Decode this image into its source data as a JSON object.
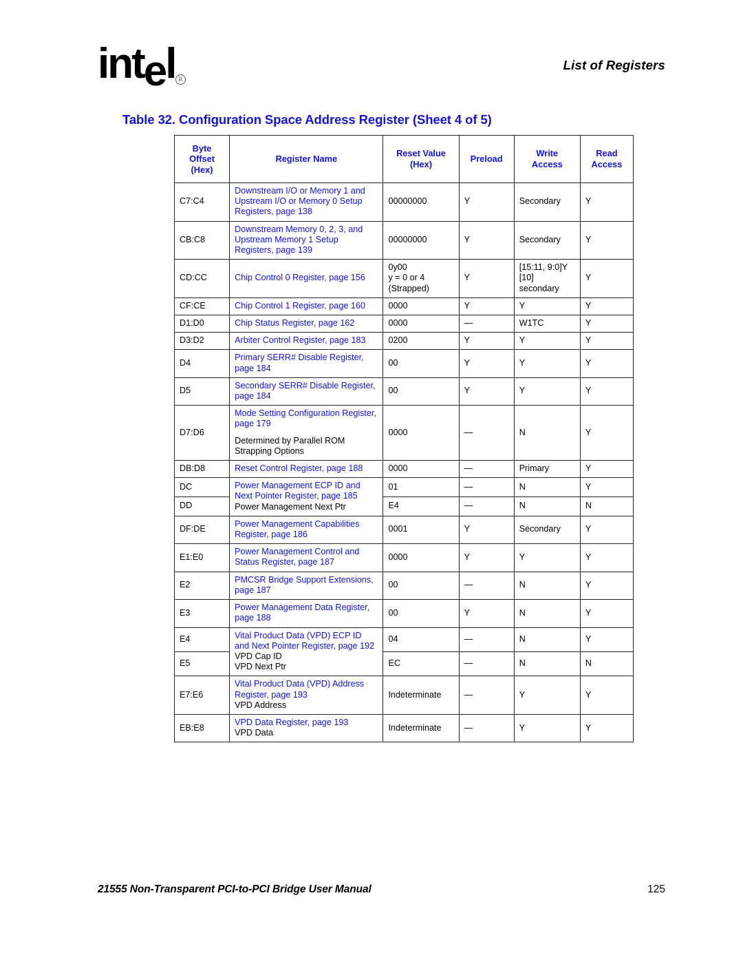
{
  "header": {
    "logo_text_before": "int",
    "logo_text_e": "e",
    "logo_text_after": "l",
    "registered_mark": "®",
    "section_title": "List of Registers"
  },
  "caption": "Table 32.  Configuration Space Address Register  (Sheet 4 of 5)",
  "table": {
    "columns": [
      {
        "label_lines": [
          "Byte",
          "Offset",
          "(Hex)"
        ]
      },
      {
        "label_lines": [
          "Register Name"
        ]
      },
      {
        "label_lines": [
          "Reset Value",
          "(Hex)"
        ]
      },
      {
        "label_lines": [
          "Preload"
        ]
      },
      {
        "label_lines": [
          "Write",
          "Access"
        ]
      },
      {
        "label_lines": [
          "Read",
          "Access"
        ]
      }
    ],
    "rows": [
      {
        "offset": "C7:C4",
        "name_parts": [
          {
            "text": "Downstream I/O or Memory 1 and Upstream I/O or Memory 0 Setup Registers, page 138",
            "link": true
          }
        ],
        "reset_parts": [
          {
            "text": "00000000"
          }
        ],
        "preload": "Y",
        "write": "Secondary",
        "read": "Y"
      },
      {
        "offset": "CB:C8",
        "name_parts": [
          {
            "text": "Downstream Memory 0, 2, 3, and Upstream Memory 1 Setup Registers, page 139",
            "link": true
          }
        ],
        "reset_parts": [
          {
            "text": "00000000"
          }
        ],
        "preload": "Y",
        "write": "Secondary",
        "read": "Y"
      },
      {
        "offset": "CD:CC",
        "name_parts": [
          {
            "text": "Chip Control 0 Register, page 156",
            "link": true
          }
        ],
        "reset_parts": [
          {
            "text": "0y00"
          },
          {
            "text": "y = 0 or 4"
          },
          {
            "text": "(Strapped)"
          }
        ],
        "preload": "Y",
        "write_parts": [
          {
            "text": "[15:11, 9:0]Y"
          },
          {
            "text": "[10]"
          },
          {
            "text": "secondary"
          }
        ],
        "read": "Y"
      },
      {
        "offset": "CF:CE",
        "name_parts": [
          {
            "text": "Chip Control 1 Register, page 160",
            "link": true
          }
        ],
        "reset_parts": [
          {
            "text": "0000"
          }
        ],
        "preload": "Y",
        "write": "Y",
        "read": "Y"
      },
      {
        "offset": "D1:D0",
        "name_parts": [
          {
            "text": "Chip Status Register, page 162",
            "link": true
          }
        ],
        "reset_parts": [
          {
            "text": "0000"
          }
        ],
        "preload": "—",
        "write": "W1TC",
        "read": "Y"
      },
      {
        "offset": "D3:D2",
        "name_parts": [
          {
            "text": "Arbiter Control Register, page 183",
            "link": true
          }
        ],
        "reset_parts": [
          {
            "text": "0200"
          }
        ],
        "preload": "Y",
        "write": "Y",
        "read": "Y"
      },
      {
        "offset": "D4",
        "name_parts": [
          {
            "text": "Primary SERR# Disable Register, page 184",
            "link": true
          }
        ],
        "reset_parts": [
          {
            "text": "00"
          }
        ],
        "preload": "Y",
        "write": "Y",
        "read": "Y"
      },
      {
        "offset": "D5",
        "name_parts": [
          {
            "text": "Secondary SERR# Disable Register, page 184",
            "link": true
          }
        ],
        "reset_parts": [
          {
            "text": "00"
          }
        ],
        "preload": "Y",
        "write": "Y",
        "read": "Y"
      },
      {
        "offset": "D7:D6",
        "name_parts": [
          {
            "text": "Mode Setting Configuration Register, page 179",
            "link": true
          },
          {
            "text": "Determined by Parallel ROM Strapping Options",
            "link": false,
            "gap": true
          }
        ],
        "reset_parts": [
          {
            "text": "0000"
          }
        ],
        "preload": "—",
        "write": "N",
        "read": "Y"
      },
      {
        "offset": "DB:D8",
        "name_parts": [
          {
            "text": "Reset Control Register, page 188",
            "link": true
          }
        ],
        "reset_parts": [
          {
            "text": "0000"
          }
        ],
        "preload": "—",
        "write": "Primary",
        "read": "Y"
      },
      {
        "offset": "DC",
        "name_parts": [
          {
            "text": "Power Management ECP ID and Next Pointer Register, page 185",
            "link": true
          },
          {
            "text": "Power Management Next Ptr",
            "link": false
          }
        ],
        "name_rowspan": 2,
        "reset_parts": [
          {
            "text": "01"
          }
        ],
        "preload": "—",
        "write": "N",
        "read": "Y"
      },
      {
        "offset": "DD",
        "name_skip": true,
        "reset_parts": [
          {
            "text": "E4"
          }
        ],
        "preload": "—",
        "write": "N",
        "read": "N"
      },
      {
        "offset": "DF:DE",
        "name_parts": [
          {
            "text": "Power Management Capabilities Register, page 186",
            "link": true
          }
        ],
        "reset_parts": [
          {
            "text": "0001"
          }
        ],
        "preload": "Y",
        "write": "Secondary",
        "read": "Y"
      },
      {
        "offset": "E1:E0",
        "name_parts": [
          {
            "text": "Power Management Control and Status Register, page 187",
            "link": true
          }
        ],
        "reset_parts": [
          {
            "text": "0000"
          }
        ],
        "preload": "Y",
        "write": "Y",
        "read": "Y"
      },
      {
        "offset": "E2",
        "name_parts": [
          {
            "text": "PMCSR Bridge Support Extensions, page 187",
            "link": true
          }
        ],
        "reset_parts": [
          {
            "text": "00"
          }
        ],
        "preload": "—",
        "write": "N",
        "read": "Y"
      },
      {
        "offset": "E3",
        "name_parts": [
          {
            "text": "Power Management Data Register, page 188",
            "link": true
          }
        ],
        "reset_parts": [
          {
            "text": "00"
          }
        ],
        "preload": "Y",
        "write": "N",
        "read": "Y"
      },
      {
        "offset": "E4",
        "name_parts": [
          {
            "text": "Vital Product Data (VPD) ECP ID and Next Pointer Register, page 192",
            "link": true
          },
          {
            "text": "VPD Cap ID",
            "link": false
          },
          {
            "text": "VPD Next Ptr",
            "link": false
          }
        ],
        "name_rowspan": 2,
        "reset_parts": [
          {
            "text": "04"
          }
        ],
        "preload": "—",
        "write": "N",
        "read": "Y"
      },
      {
        "offset": "E5",
        "name_skip": true,
        "reset_parts": [
          {
            "text": "EC"
          }
        ],
        "preload": "—",
        "write": "N",
        "read": "N"
      },
      {
        "offset": "E7:E6",
        "name_parts": [
          {
            "text": "Vital Product Data (VPD) Address Register, page 193",
            "link": true
          },
          {
            "text": "VPD Address",
            "link": false
          }
        ],
        "reset_parts": [
          {
            "text": "Indeterminate"
          }
        ],
        "preload": "—",
        "write": "Y",
        "read": "Y"
      },
      {
        "offset": "EB:E8",
        "name_parts": [
          {
            "text": "VPD Data Register, page 193",
            "link": true
          },
          {
            "text": "VPD Data",
            "link": false
          }
        ],
        "reset_parts": [
          {
            "text": "Indeterminate"
          }
        ],
        "preload": "—",
        "write": "Y",
        "read": "Y"
      }
    ]
  },
  "footer": {
    "manual_title": "21555 Non-Transparent PCI-to-PCI Bridge User Manual",
    "page_number": "125"
  },
  "colors": {
    "link_blue": "#1414d6",
    "text_black": "#000000",
    "border": "#222222"
  }
}
